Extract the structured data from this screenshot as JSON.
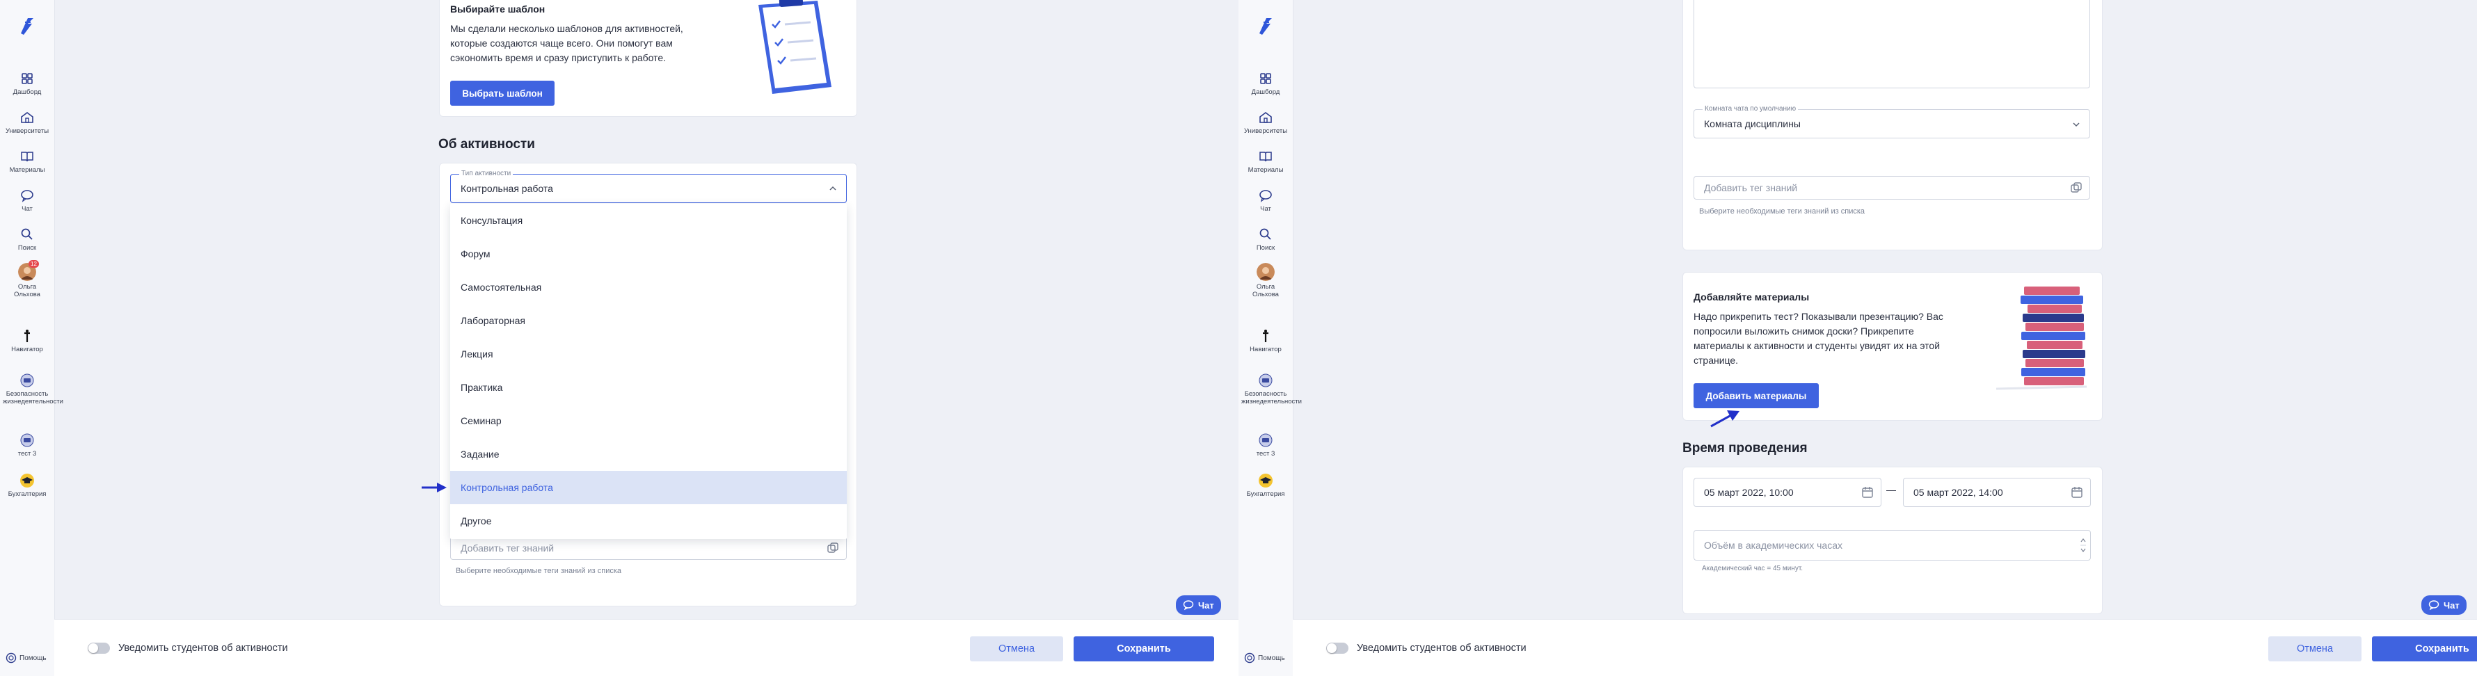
{
  "sidebar": {
    "items": [
      {
        "label": "Дашборд",
        "icon": "dashboard-icon"
      },
      {
        "label": "Университеты",
        "icon": "university-icon"
      },
      {
        "label": "Материалы",
        "icon": "book-icon"
      },
      {
        "label": "Чат",
        "icon": "chat-icon"
      },
      {
        "label": "Поиск",
        "icon": "search-icon"
      },
      {
        "label": "Ольга Ольхова",
        "icon": "avatar",
        "badge": "12"
      },
      {
        "label": "Навигатор",
        "icon": "navigator-icon"
      },
      {
        "label": "Безопасность жизнедеятельности",
        "icon": "course-icon"
      },
      {
        "label": "тест 3",
        "icon": "course-icon"
      },
      {
        "label": "Бухгалтерия",
        "icon": "graduation-cap-icon"
      }
    ],
    "help": "Помощь"
  },
  "left": {
    "template_card": {
      "title": "Выбирайте шаблон",
      "text_lines": [
        "Мы сделали несколько шаблонов для активностей,",
        "которые создаются чаще всего. Они помогут вам",
        "сэкономить время и сразу приступить к работе."
      ],
      "button": "Выбрать шаблон"
    },
    "about_title": "Об активности",
    "activity_type": {
      "legend": "Тип активности",
      "value": "Контрольная работа"
    },
    "dropdown_options": [
      "Консультация",
      "Форум",
      "Самостоятельная",
      "Лабораторная",
      "Лекция",
      "Практика",
      "Семинар",
      "Задание",
      "Контрольная работа",
      "Другое"
    ],
    "dropdown_selected": "Контрольная работа",
    "tag_field": {
      "placeholder": "Добавить тег знаний",
      "hint": "Выберите необходимые теги знаний из списка"
    }
  },
  "right": {
    "chat_room": {
      "legend": "Комната чата по умолчанию",
      "value": "Комната дисциплины"
    },
    "tag_field": {
      "placeholder": "Добавить тег знаний",
      "hint": "Выберите необходимые теги знаний из списка"
    },
    "materials_card": {
      "title": "Добавляйте материалы",
      "text_lines": [
        "Надо прикрепить тест? Показывали презентацию? Вас",
        "попросили выложить снимок доски? Прикрепите",
        "материалы к активности и студенты увидят их на этой",
        "странице."
      ],
      "button": "Добавить материалы"
    },
    "time_title": "Время проведения",
    "start_date": "05 март 2022, 10:00",
    "dash": "—",
    "end_date": "05 март 2022, 14:00",
    "hours": {
      "placeholder": "Объём в академических часах",
      "hint": "Академический час = 45 минут."
    }
  },
  "bottom": {
    "notify_label": "Уведомить студентов об активности",
    "cancel": "Отмена",
    "save": "Сохранить",
    "chat": "Чат"
  },
  "colors": {
    "accent": "#3f63e0",
    "selected_bg": "#dbe3f6"
  }
}
